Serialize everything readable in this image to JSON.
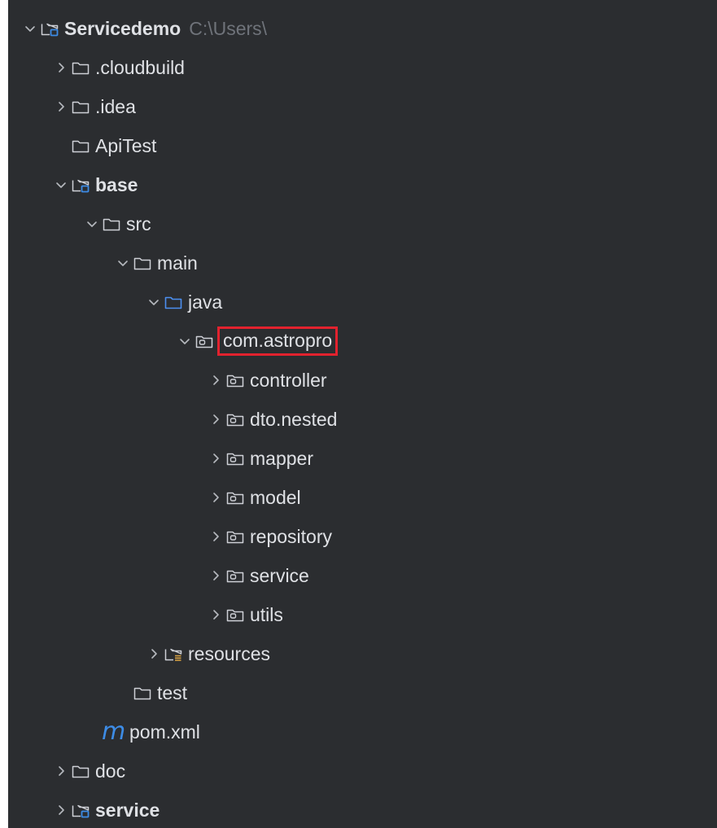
{
  "tree": [
    {
      "label": "Servicedemo",
      "path": "C:\\Users\\",
      "indent": 0,
      "chevron": "down",
      "icon": "module-folder-icon",
      "bold": true
    },
    {
      "label": ".cloudbuild",
      "indent": 1,
      "chevron": "right",
      "icon": "folder-icon"
    },
    {
      "label": ".idea",
      "indent": 1,
      "chevron": "right",
      "icon": "folder-icon"
    },
    {
      "label": "ApiTest",
      "indent": 1,
      "chevron": "none",
      "icon": "folder-icon"
    },
    {
      "label": "base",
      "indent": 1,
      "chevron": "down",
      "icon": "module-folder-icon",
      "bold": true
    },
    {
      "label": "src",
      "indent": 2,
      "chevron": "down",
      "icon": "folder-icon"
    },
    {
      "label": "main",
      "indent": 3,
      "chevron": "down",
      "icon": "folder-icon"
    },
    {
      "label": "java",
      "indent": 4,
      "chevron": "down",
      "icon": "source-folder-icon"
    },
    {
      "label": "com.astropro",
      "indent": 5,
      "chevron": "down",
      "icon": "package-icon",
      "highlight": true
    },
    {
      "label": "controller",
      "indent": 6,
      "chevron": "right",
      "icon": "package-icon"
    },
    {
      "label": "dto.nested",
      "indent": 6,
      "chevron": "right",
      "icon": "package-icon"
    },
    {
      "label": "mapper",
      "indent": 6,
      "chevron": "right",
      "icon": "package-icon"
    },
    {
      "label": "model",
      "indent": 6,
      "chevron": "right",
      "icon": "package-icon"
    },
    {
      "label": "repository",
      "indent": 6,
      "chevron": "right",
      "icon": "package-icon"
    },
    {
      "label": "service",
      "indent": 6,
      "chevron": "right",
      "icon": "package-icon"
    },
    {
      "label": "utils",
      "indent": 6,
      "chevron": "right",
      "icon": "package-icon"
    },
    {
      "label": "resources",
      "indent": 4,
      "chevron": "right",
      "icon": "resources-folder-icon"
    },
    {
      "label": "test",
      "indent": 3,
      "chevron": "none",
      "icon": "folder-icon"
    },
    {
      "label": "pom.xml",
      "indent": 2,
      "chevron": "none",
      "icon": "maven-file-icon",
      "icon_text": "m"
    },
    {
      "label": "doc",
      "indent": 1,
      "chevron": "right",
      "icon": "folder-icon"
    },
    {
      "label": "service",
      "indent": 1,
      "chevron": "right",
      "icon": "module-folder-icon",
      "bold": true
    }
  ],
  "colors": {
    "background": "#2b2d30",
    "text": "#dfe1e5",
    "path_text": "#6f737a",
    "source_folder": "#4c8ff0",
    "module_badge": "#3d8ce6",
    "highlight_border": "#e2222e"
  }
}
